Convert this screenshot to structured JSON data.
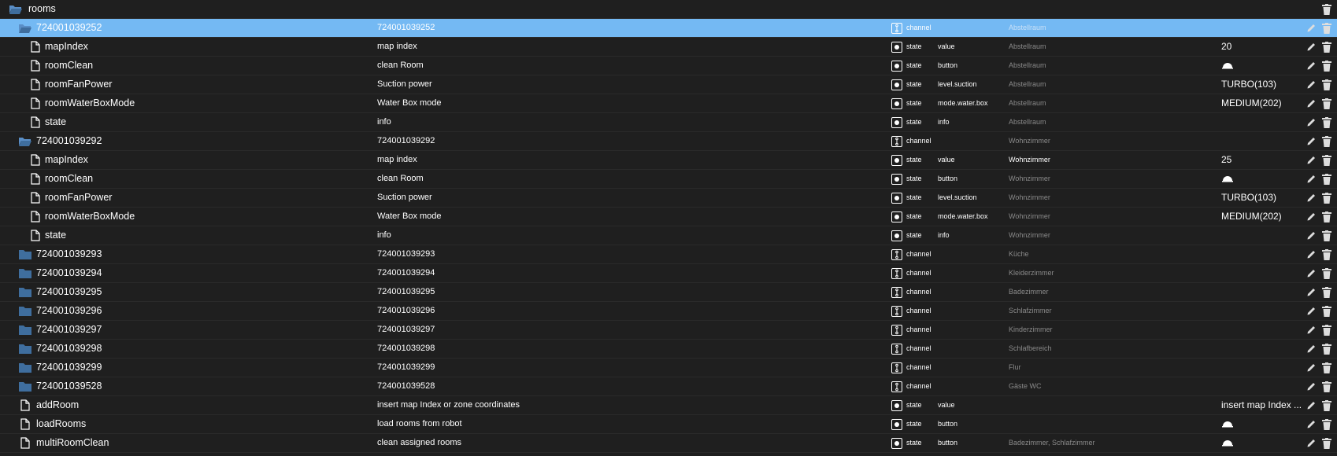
{
  "colors": {
    "background": "#1f1f1f",
    "selected_row": "#74b9f3",
    "folder_closed": "#3f6e9e",
    "folder_open": "#5a8ec6",
    "muted_text": "#8a8a8a"
  },
  "root": {
    "label": "rooms",
    "icon": "folder-open-icon"
  },
  "rows": [
    {
      "name": "724001039252",
      "title": "724001039252",
      "type": "channel",
      "role": "",
      "room": "Abstellraum",
      "value": "",
      "indent": 1,
      "kind": "folder-open",
      "selected": true
    },
    {
      "name": "mapIndex",
      "title": "map index",
      "type": "state",
      "role": "value",
      "room": "Abstellraum",
      "value": "20",
      "indent": 2,
      "kind": "file"
    },
    {
      "name": "roomClean",
      "title": "clean Room",
      "type": "state",
      "role": "button",
      "room": "Abstellraum",
      "value": "",
      "indent": 2,
      "kind": "file",
      "button": true
    },
    {
      "name": "roomFanPower",
      "title": "Suction power",
      "type": "state",
      "role": "level.suction",
      "room": "Abstellraum",
      "value": "TURBO(103)",
      "indent": 2,
      "kind": "file"
    },
    {
      "name": "roomWaterBoxMode",
      "title": "Water Box mode",
      "type": "state",
      "role": "mode.water.box",
      "room": "Abstellraum",
      "value": "MEDIUM(202)",
      "indent": 2,
      "kind": "file"
    },
    {
      "name": "state",
      "title": "info",
      "type": "state",
      "role": "info",
      "room": "Abstellraum",
      "value": "",
      "indent": 2,
      "kind": "file"
    },
    {
      "name": "724001039292",
      "title": "724001039292",
      "type": "channel",
      "role": "",
      "room": "Wohnzimmer",
      "value": "",
      "indent": 1,
      "kind": "folder-open"
    },
    {
      "name": "mapIndex",
      "title": "map index",
      "type": "state",
      "role": "value",
      "room": "Wohnzimmer",
      "value": "25",
      "indent": 2,
      "kind": "file",
      "roomBright": true
    },
    {
      "name": "roomClean",
      "title": "clean Room",
      "type": "state",
      "role": "button",
      "room": "Wohnzimmer",
      "value": "",
      "indent": 2,
      "kind": "file",
      "button": true
    },
    {
      "name": "roomFanPower",
      "title": "Suction power",
      "type": "state",
      "role": "level.suction",
      "room": "Wohnzimmer",
      "value": "TURBO(103)",
      "indent": 2,
      "kind": "file"
    },
    {
      "name": "roomWaterBoxMode",
      "title": "Water Box mode",
      "type": "state",
      "role": "mode.water.box",
      "room": "Wohnzimmer",
      "value": "MEDIUM(202)",
      "indent": 2,
      "kind": "file"
    },
    {
      "name": "state",
      "title": "info",
      "type": "state",
      "role": "info",
      "room": "Wohnzimmer",
      "value": "",
      "indent": 2,
      "kind": "file"
    },
    {
      "name": "724001039293",
      "title": "724001039293",
      "type": "channel",
      "role": "",
      "room": "Küche",
      "value": "",
      "indent": 1,
      "kind": "folder"
    },
    {
      "name": "724001039294",
      "title": "724001039294",
      "type": "channel",
      "role": "",
      "room": "Kleiderzimmer",
      "value": "",
      "indent": 1,
      "kind": "folder"
    },
    {
      "name": "724001039295",
      "title": "724001039295",
      "type": "channel",
      "role": "",
      "room": "Badezimmer",
      "value": "",
      "indent": 1,
      "kind": "folder"
    },
    {
      "name": "724001039296",
      "title": "724001039296",
      "type": "channel",
      "role": "",
      "room": "Schlafzimmer",
      "value": "",
      "indent": 1,
      "kind": "folder"
    },
    {
      "name": "724001039297",
      "title": "724001039297",
      "type": "channel",
      "role": "",
      "room": "Kinderzimmer",
      "value": "",
      "indent": 1,
      "kind": "folder"
    },
    {
      "name": "724001039298",
      "title": "724001039298",
      "type": "channel",
      "role": "",
      "room": "Schlafbereich",
      "value": "",
      "indent": 1,
      "kind": "folder"
    },
    {
      "name": "724001039299",
      "title": "724001039299",
      "type": "channel",
      "role": "",
      "room": "Flur",
      "value": "",
      "indent": 1,
      "kind": "folder"
    },
    {
      "name": "724001039528",
      "title": "724001039528",
      "type": "channel",
      "role": "",
      "room": "Gäste WC",
      "value": "",
      "indent": 1,
      "kind": "folder"
    },
    {
      "name": "addRoom",
      "title": "insert map Index or zone coordinates",
      "type": "state",
      "role": "value",
      "room": "",
      "value": "insert map Index ...",
      "indent": 1,
      "kind": "file"
    },
    {
      "name": "loadRooms",
      "title": "load rooms from robot",
      "type": "state",
      "role": "button",
      "room": "",
      "value": "",
      "indent": 1,
      "kind": "file",
      "button": true
    },
    {
      "name": "multiRoomClean",
      "title": "clean assigned rooms",
      "type": "state",
      "role": "button",
      "room": "Badezimmer, Schlafzimmer",
      "value": "",
      "indent": 1,
      "kind": "file",
      "button": true
    }
  ]
}
